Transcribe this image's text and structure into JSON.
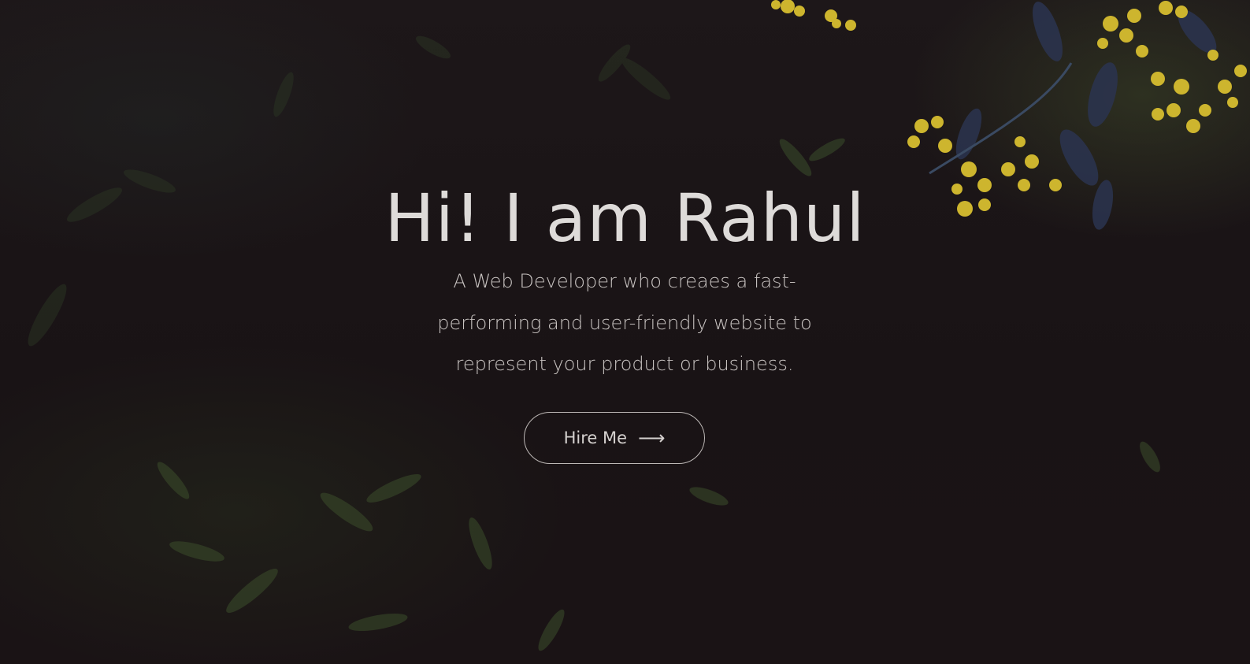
{
  "hero": {
    "title": "Hi! I am Rahul",
    "subtitle": "A Web Developer who creaes a fast-performing and user-friendly website to represent your product or business.",
    "cta": {
      "label": "Hire Me",
      "icon": "arrow-right-icon",
      "glyph": "⟶"
    }
  },
  "colors": {
    "background": "#1a1416",
    "text": "#dedbd9",
    "accent_flowers": "#d9c23a"
  }
}
